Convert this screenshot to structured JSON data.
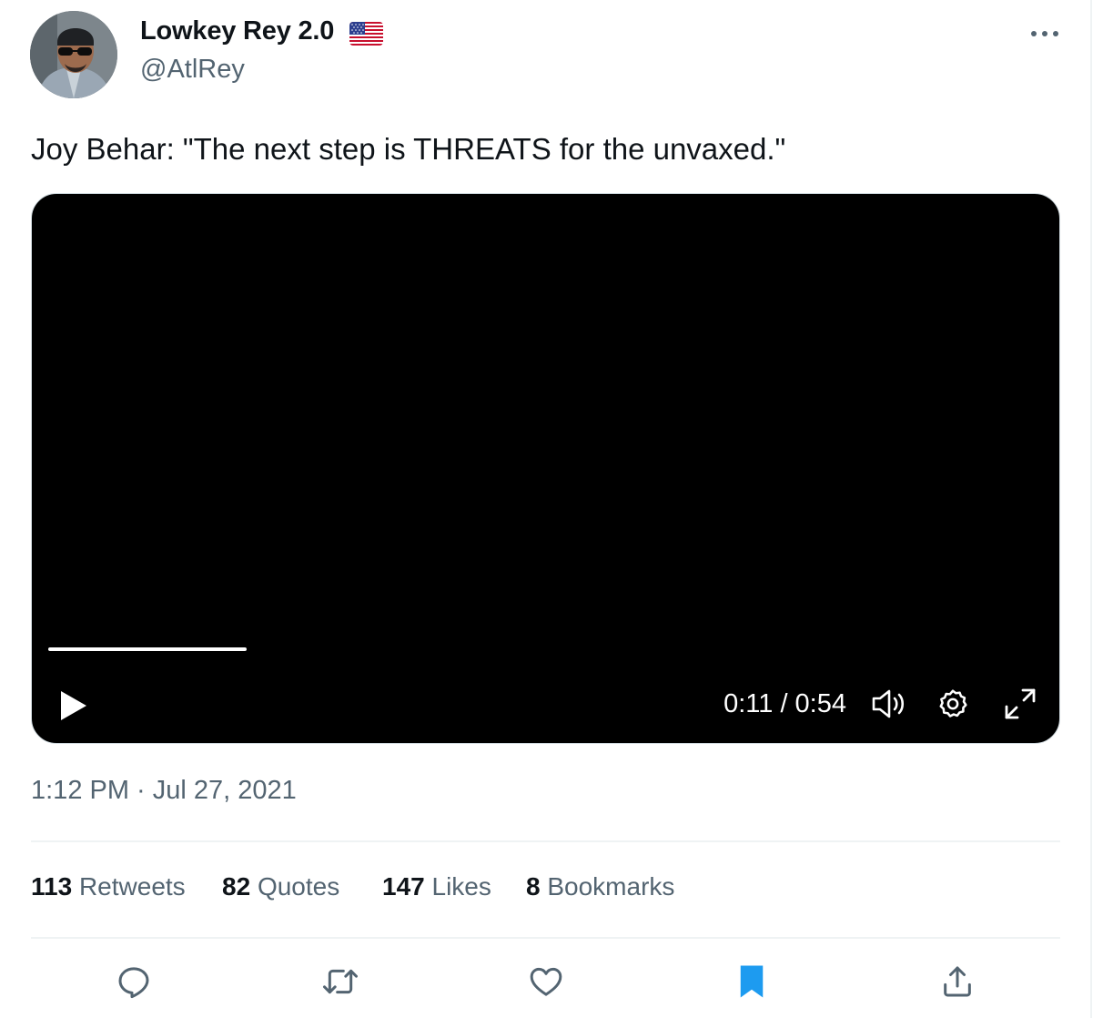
{
  "author": {
    "display_name": "Lowkey Rey 2.0",
    "handle": "@AtlRey",
    "flag_icon": "us-flag-icon"
  },
  "tweet": {
    "text": "Joy Behar: \"The next step is THREATS for the unvaxed.\"",
    "timestamp": "1:12 PM · Jul 27, 2021"
  },
  "video": {
    "current_time": "0:11",
    "duration": "0:54",
    "time_display": "0:11 / 0:54",
    "progress_fraction": 0.2
  },
  "stats": [
    {
      "count": "113",
      "label": "Retweets"
    },
    {
      "count": "82",
      "label": "Quotes"
    },
    {
      "count": "147",
      "label": "Likes"
    },
    {
      "count": "8",
      "label": "Bookmarks"
    }
  ],
  "actions": [
    "reply-icon",
    "retweet-icon",
    "like-icon",
    "bookmark-icon",
    "share-icon"
  ],
  "colors": {
    "text_primary": "#0f1419",
    "text_secondary": "#536471",
    "accent": "#1d9bf0"
  }
}
